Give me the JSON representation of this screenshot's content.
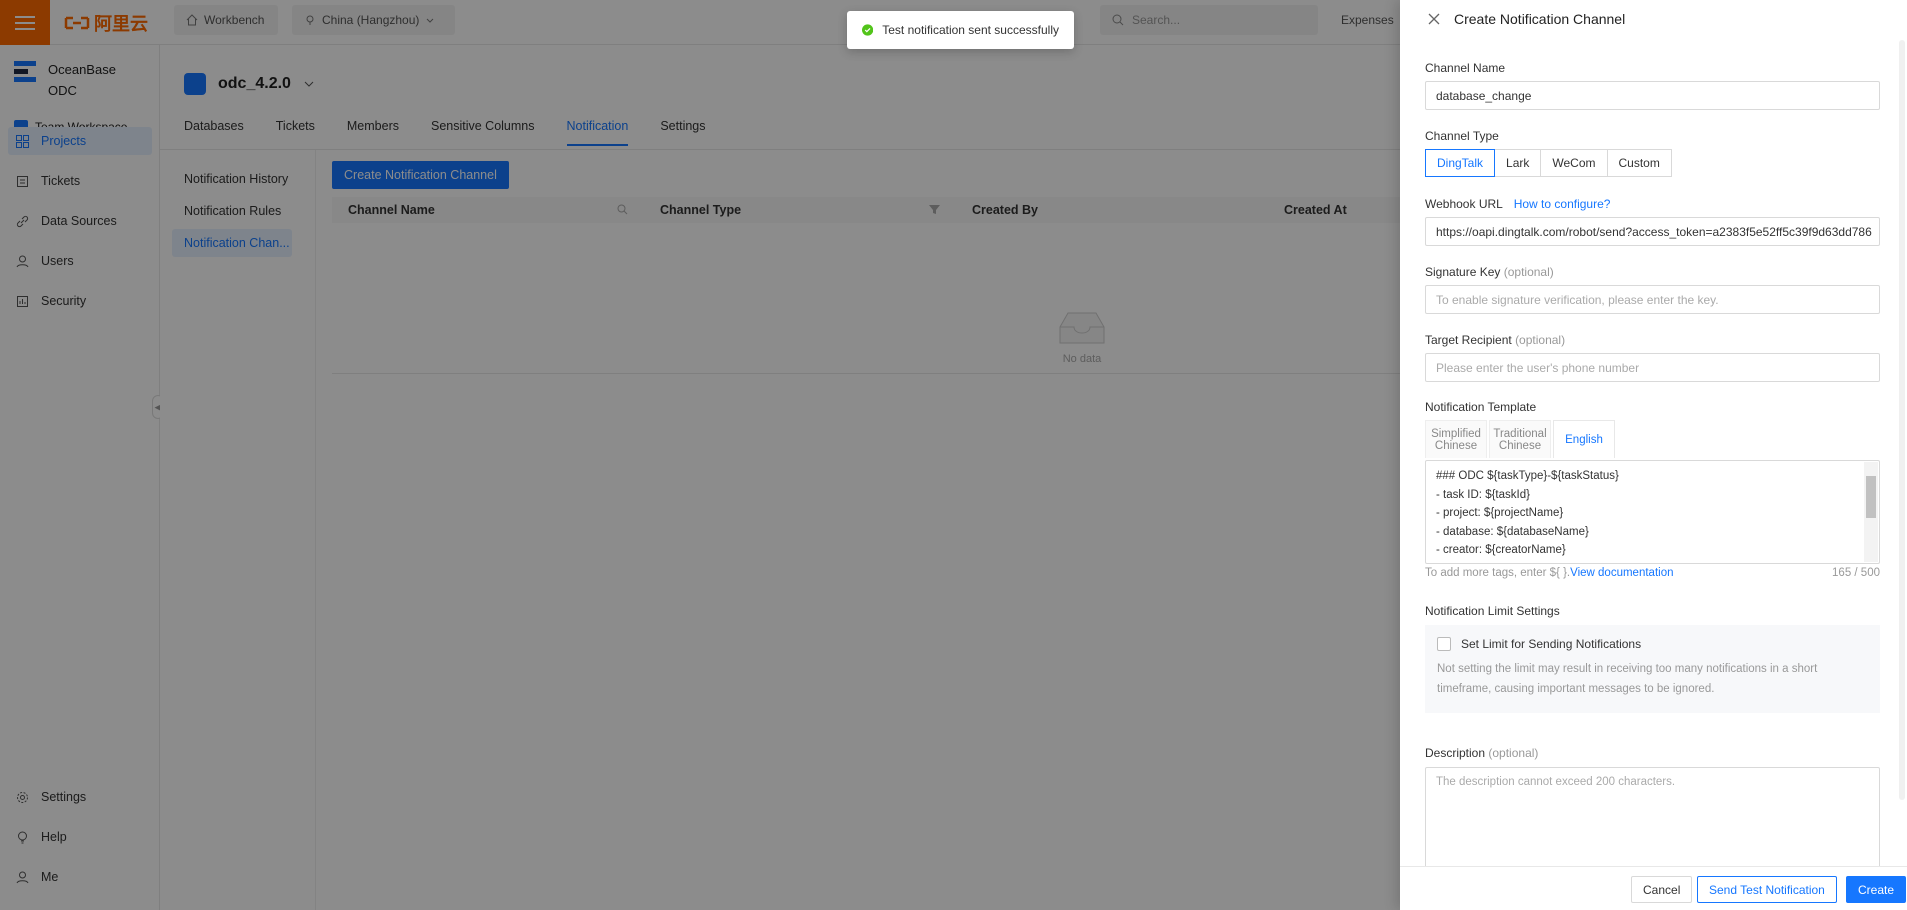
{
  "topbar": {
    "logo_text": "阿里云",
    "workbench": "Workbench",
    "region": "China (Hangzhou)",
    "search_placeholder": "Search...",
    "expenses": "Expenses"
  },
  "sidebar": {
    "brand_line1": "OceanBase",
    "brand_line2": "ODC",
    "workspace": "Team Workspace",
    "items": [
      {
        "label": "Projects",
        "icon": "grid-icon"
      },
      {
        "label": "Tickets",
        "icon": "ticket-icon"
      },
      {
        "label": "Data Sources",
        "icon": "link-icon"
      },
      {
        "label": "Users",
        "icon": "user-icon"
      },
      {
        "label": "Security",
        "icon": "shield-icon"
      }
    ],
    "bottom": [
      {
        "label": "Settings",
        "icon": "gear-icon"
      },
      {
        "label": "Help",
        "icon": "bulb-icon"
      },
      {
        "label": "Me",
        "icon": "person-icon"
      }
    ],
    "collapse_glyph": "◀"
  },
  "project": {
    "name": "odc_4.2.0",
    "tabs": [
      "Databases",
      "Tickets",
      "Members",
      "Sensitive Columns",
      "Notification",
      "Settings"
    ],
    "active_tab": "Notification"
  },
  "subnav": {
    "items": [
      "Notification History",
      "Notification Rules",
      "Notification Chan..."
    ]
  },
  "table": {
    "create_button": "Create Notification Channel",
    "columns": [
      "Channel Name",
      "Channel Type",
      "Created By",
      "Created At"
    ],
    "empty_text": "No data"
  },
  "toast": {
    "message": "Test notification sent successfully"
  },
  "drawer": {
    "title": "Create Notification Channel",
    "channel_name_label": "Channel Name",
    "channel_name_value": "database_change",
    "channel_type_label": "Channel Type",
    "channel_types": [
      "DingTalk",
      "Lark",
      "WeCom",
      "Custom"
    ],
    "channel_type_selected": "DingTalk",
    "webhook_label": "Webhook URL",
    "webhook_link": "How to configure?",
    "webhook_value": "https://oapi.dingtalk.com/robot/send?access_token=a2383f5e52ff5c39f9d63dd786",
    "signature_label": "Signature Key",
    "optional": "(optional)",
    "signature_placeholder": "To enable signature verification, please enter the key.",
    "recipient_label": "Target Recipient",
    "recipient_placeholder": "Please enter the user's phone number",
    "template_label": "Notification Template",
    "template_tabs": [
      {
        "line1": "Simplified",
        "line2": "Chinese"
      },
      {
        "line1": "Traditional",
        "line2": "Chinese"
      },
      {
        "line1": "English",
        "line2": ""
      }
    ],
    "template_lines": [
      "### ODC ${taskType}-${taskStatus}",
      "- task ID: ${taskId}",
      "- project: ${projectName}",
      "- database: ${databaseName}",
      "- creator: ${creatorName}"
    ],
    "template_hint": "To add more tags, enter ${ }.",
    "template_hint_link": "View documentation",
    "template_count": "165 / 500",
    "limit_label": "Notification Limit Settings",
    "limit_checkbox": "Set Limit for Sending Notifications",
    "limit_note": "Not setting the limit may result in receiving too many notifications in a short timeframe, causing important messages to be ignored.",
    "description_label": "Description",
    "description_placeholder": "The description cannot exceed 200 characters.",
    "buttons": {
      "cancel": "Cancel",
      "send_test": "Send Test Notification",
      "create": "Create"
    }
  },
  "colors": {
    "accent": "#1677ff",
    "brand": "#ff6a00",
    "success": "#52c41a"
  }
}
